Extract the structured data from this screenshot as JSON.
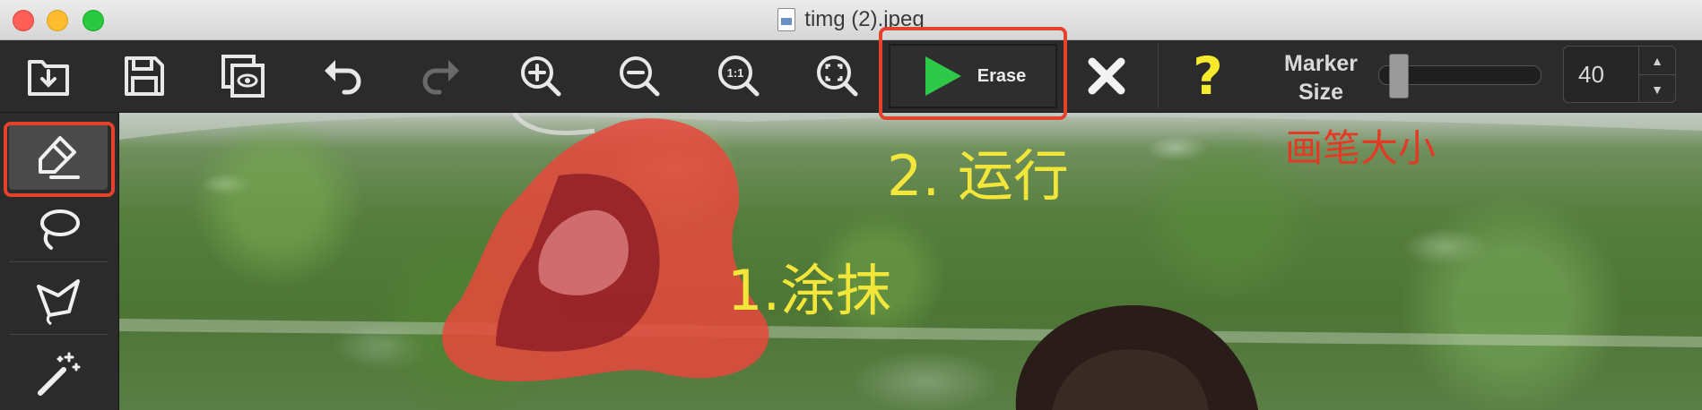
{
  "window": {
    "title": "timg (2).jpeg"
  },
  "toolbar": {
    "items": [
      {
        "icon": "import-icon"
      },
      {
        "icon": "save-icon"
      },
      {
        "icon": "preview-compare-icon"
      },
      {
        "icon": "undo-icon"
      },
      {
        "icon": "redo-icon",
        "disabled": true
      },
      {
        "icon": "zoom-in-icon"
      },
      {
        "icon": "zoom-out-icon"
      },
      {
        "icon": "zoom-actual-size-icon",
        "text": "1:1"
      },
      {
        "icon": "zoom-fit-icon"
      }
    ],
    "erase_label": "Erase",
    "marker_label_line1": "Marker",
    "marker_label_line2": "Size",
    "marker_size_value": "40",
    "marker_size_fraction": 0.05,
    "help_symbol": "?",
    "stepper_up": "▲",
    "stepper_down": "▼"
  },
  "tools": [
    {
      "icon": "marker-brush-icon",
      "active": true
    },
    {
      "icon": "lasso-icon",
      "active": false
    },
    {
      "icon": "polygon-lasso-icon",
      "active": false
    },
    {
      "icon": "magic-wand-icon",
      "active": false
    }
  ],
  "annotations": {
    "step1": "1.涂抹",
    "step2": "2. 运行",
    "brush_size": "画笔大小"
  },
  "colors": {
    "highlight": "#e3432b",
    "annotation_text": "#f2e63a",
    "play_green": "#2fc94a",
    "help_yellow": "#f6ea2f",
    "mask_red": "#e8483c"
  }
}
